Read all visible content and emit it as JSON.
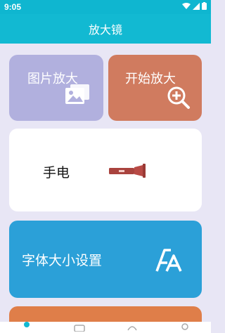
{
  "status_bar": {
    "time": "9:05"
  },
  "header": {
    "title": "放大镜"
  },
  "cards": {
    "image_zoom": {
      "label": "图片放大"
    },
    "start_zoom": {
      "label": "开始放大"
    },
    "flashlight": {
      "label": "手电"
    },
    "font_size": {
      "label": "字体大小设置"
    }
  },
  "colors": {
    "accent": "#12b9d2",
    "image_card": "#b1b0de",
    "start_card": "#d07b5f",
    "font_card": "#2ba0d8",
    "next_card": "#df7e49",
    "background": "#e8e6f5"
  },
  "icons": {
    "status": [
      "wifi-icon",
      "signal-icon",
      "battery-icon"
    ],
    "image_card": "image-gallery-icon",
    "start_card": "zoom-in-icon",
    "flashlight_card": "flashlight-icon",
    "font_card": "font-size-icon",
    "nav": [
      "home-icon",
      "card-icon",
      "settings-icon",
      "profile-icon"
    ]
  }
}
